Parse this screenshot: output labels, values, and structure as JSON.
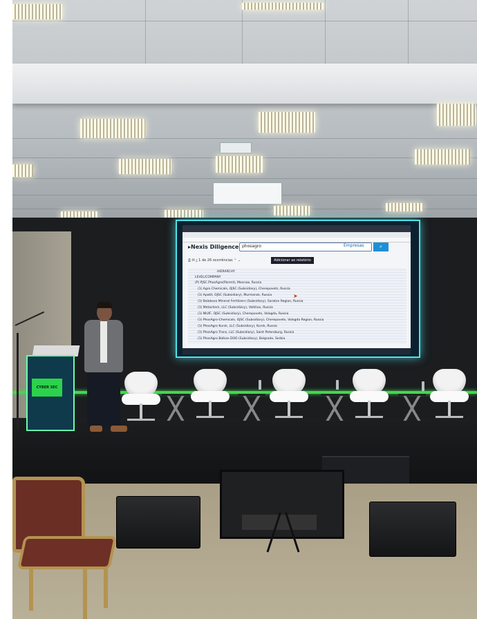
{
  "screen": {
    "brand": "Nexis Diligence+",
    "search_query": "phosagro",
    "search_button": "Empresas",
    "result_count": "1 de 26 ocorrências",
    "report_button": "Adicionar ao relatório",
    "hierarchy_header": "HIERARCHY",
    "company_header": "LEVEL/COMPANY",
    "rows": [
      "(P) PJSC PhosAgro(Parent), Moscow, Russia",
      "(1) Agro Chemicals, OJSC (Subsidiary), Cherepovets, Russia",
      "(1) Apatit, OJSC (Subsidiary), Murmansk, Russia",
      "(1) Balakovo Mineral Fertilizers (Subsidiary), Saratov Region, Russia",
      "(1) Metachem, LLC (Subsidiary), Volkhov, Russia",
      "(1) NIUIF, OJSC (Subsidiary), Cherepovets, Vologda, Russia",
      "(1) PhosAgro-Chemicals, OJSC (Subsidiary), Cherepovets, Vologda Region, Russia",
      "(1) PhosAgro Kursk, LLC (Subsidiary), Kursk, Russia",
      "(1) PhosAgro Trans, LLC (Subsidiary), Saint Petersburg, Russia",
      "(1) PhosAgro Balkan DOO (Subsidiary), Belgrade, Serbia"
    ]
  },
  "lectern": {
    "logo_text": "CYBER SEC"
  }
}
